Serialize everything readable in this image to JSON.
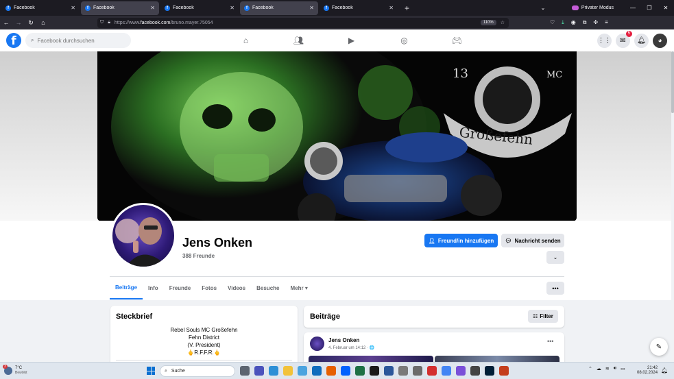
{
  "browser": {
    "tabs": [
      {
        "title": "Facebook",
        "active": false
      },
      {
        "title": "Facebook",
        "active": true
      },
      {
        "title": "Facebook",
        "active": false
      },
      {
        "title": "Facebook",
        "active": true
      },
      {
        "title": "Facebook",
        "active": false
      }
    ],
    "private_label": "Privater Modus",
    "url_prefix": "https://www.",
    "url_host": "facebook.com",
    "url_path": "/bruno.mayer.75054",
    "zoom": "110%"
  },
  "facebook": {
    "search_placeholder": "Facebook durchsuchen",
    "messenger_badge": "5",
    "profile": {
      "name": "Jens Onken",
      "friends": "388 Freunde",
      "add_friend_label": "Freund/in hinzufügen",
      "message_label": "Nachricht senden"
    },
    "cover_text": {
      "number": "13",
      "mc": "MC",
      "place": "Großefehn"
    },
    "tabs": [
      "Beiträge",
      "Info",
      "Freunde",
      "Fotos",
      "Videos",
      "Besuche",
      "Mehr ▾"
    ],
    "intro": {
      "title": "Steckbrief",
      "lines": [
        "Rebel Souls MC Großefehn",
        "Fehn District",
        "(V. President)",
        "🖕R.F.F.R.🖕"
      ]
    },
    "posts": {
      "title": "Beiträge",
      "filter_label": "Filter",
      "post": {
        "author": "Jens Onken",
        "meta": "4. Februar um 14:12 · 🌐"
      }
    },
    "colors": {
      "brand": "#1877f2",
      "text": "#050505",
      "secondary": "#65676b"
    }
  },
  "taskbar": {
    "weather_temp": "7°C",
    "weather_desc": "Bewölkt",
    "weather_badge": "3",
    "search_label": "Suche",
    "time": "21:42",
    "date": "08.02.2024"
  }
}
